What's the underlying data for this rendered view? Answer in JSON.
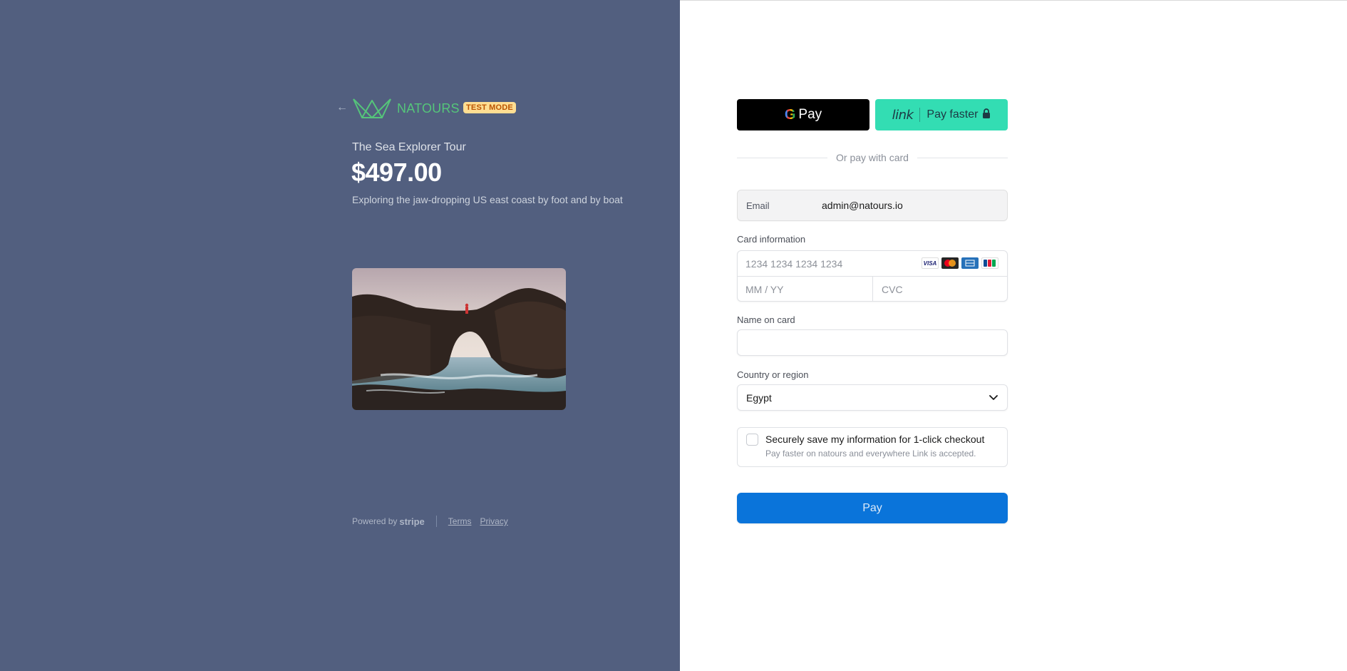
{
  "merchant": {
    "name": "NATOURS",
    "test_badge": "TEST MODE"
  },
  "product": {
    "name": "The Sea Explorer Tour",
    "price": "$497.00",
    "description": "Exploring the jaw-dropping US east coast by foot and by boat"
  },
  "footer": {
    "powered_by": "Powered by",
    "stripe": "stripe",
    "terms": "Terms",
    "privacy": "Privacy"
  },
  "express": {
    "gpay_g": "G",
    "gpay_label": "Pay",
    "link_word": "link",
    "link_label": "Pay faster"
  },
  "divider_text": "Or pay with card",
  "email": {
    "label": "Email",
    "value": "admin@natours.io"
  },
  "card": {
    "label": "Card information",
    "number_placeholder": "1234 1234 1234 1234",
    "expiry_placeholder": "MM / YY",
    "cvc_placeholder": "CVC",
    "brands": [
      "VISA",
      "Mastercard",
      "AMEX",
      "JCB"
    ]
  },
  "name_on_card": {
    "label": "Name on card",
    "value": ""
  },
  "country": {
    "label": "Country or region",
    "selected": "Egypt"
  },
  "save_info": {
    "title": "Securely save my information for 1-click checkout",
    "subtitle": "Pay faster on natours and everywhere Link is accepted.",
    "checked": false
  },
  "pay_button": "Pay",
  "colors": {
    "left_bg": "#525f7f",
    "brand_green": "#55c57a",
    "link_green": "#33ddb3",
    "pay_blue": "#0a74da"
  }
}
